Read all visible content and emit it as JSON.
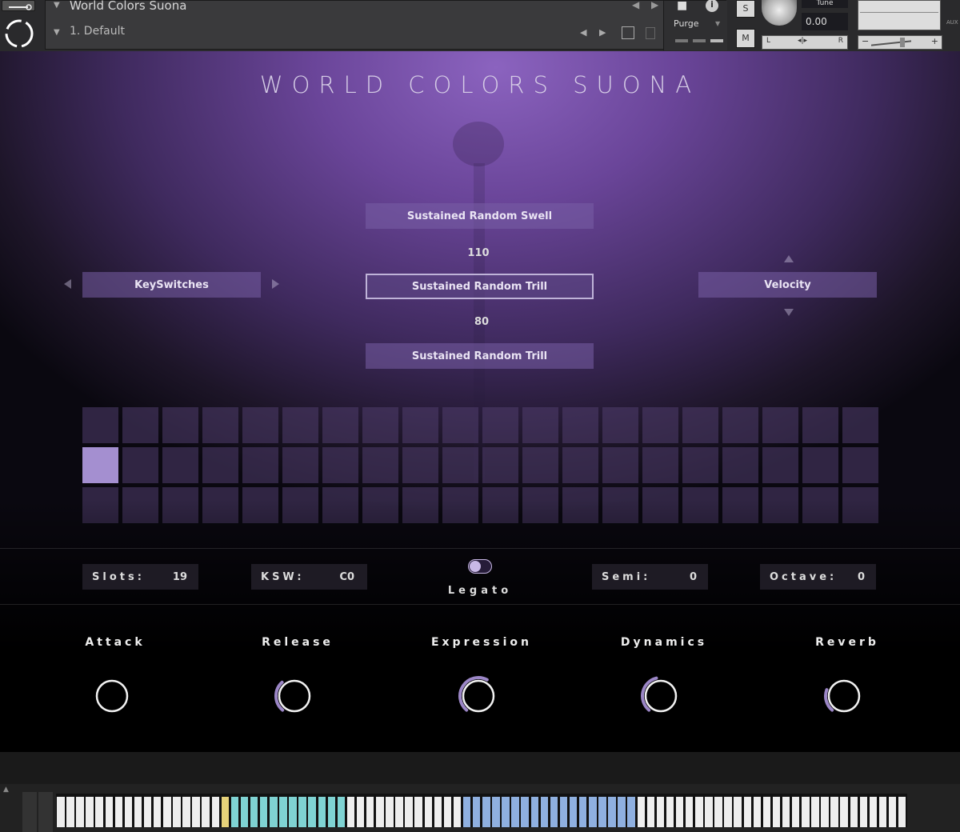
{
  "header": {
    "instrument_name": "World Colors Suona",
    "preset_name": "1. Default",
    "purge_label": "Purge",
    "tune_label": "Tune",
    "tune_value": "0.00",
    "solo_label": "S",
    "mute_label": "M",
    "pan_left": "L",
    "pan_right": "R",
    "aux_label": "AUX",
    "vol_minus": "−",
    "vol_plus": "+"
  },
  "main": {
    "title": "WORLD COLORS SUONA",
    "articulation_top": "Sustained Random Swell",
    "value_upper": "110",
    "articulation_selected": "Sustained Random Trill",
    "value_lower": "80",
    "articulation_bottom": "Sustained Random Trill",
    "keyswitches_label": "KeySwitches",
    "velocity_label": "Velocity"
  },
  "grid": {
    "rows": 3,
    "cols": 20,
    "active_row": 2,
    "active_col": 1
  },
  "params": {
    "slots_label": "Slots:",
    "slots_value": "19",
    "ksw_label": "KSW:",
    "ksw_value": "C0",
    "legato_label": "Legato",
    "semi_label": "Semi:",
    "semi_value": "0",
    "octave_label": "Octave:",
    "octave_value": "0"
  },
  "knobs": [
    {
      "label": "Attack",
      "level": 0.0
    },
    {
      "label": "Release",
      "level": 0.35
    },
    {
      "label": "Expression",
      "level": 0.6
    },
    {
      "label": "Dynamics",
      "level": 0.45
    },
    {
      "label": "Reverb",
      "level": 0.25
    }
  ],
  "colors": {
    "accent": "#a48fd0",
    "knob_arc": "#9b86c6",
    "key_cyan": "#7fd3d3",
    "key_blue": "#8fb0e0"
  }
}
